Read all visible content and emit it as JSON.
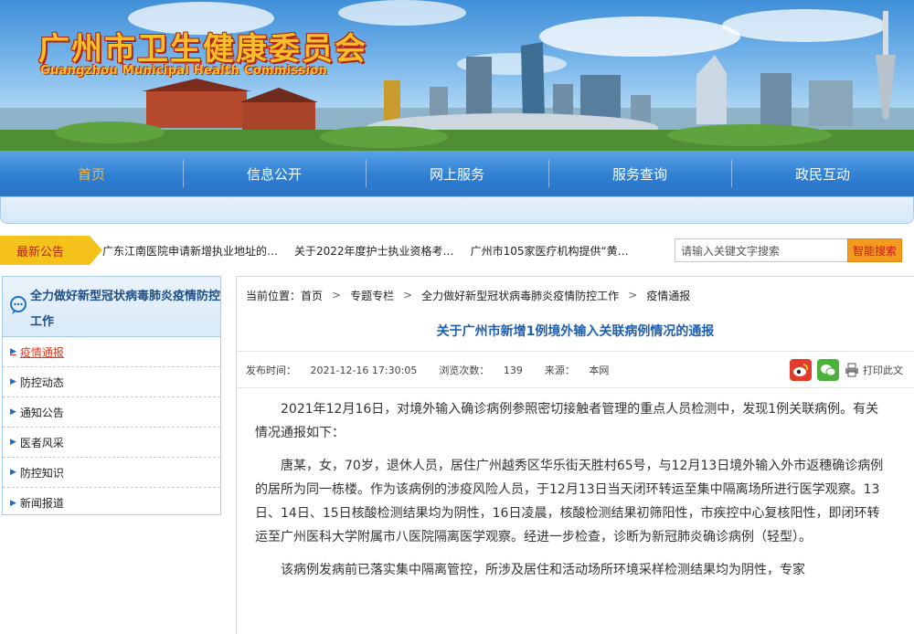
{
  "banner": {
    "title": "广州市卫生健康委员会",
    "subtitle": "Guangzhou Municipal Health Commission"
  },
  "nav": {
    "items": [
      {
        "label": "首页"
      },
      {
        "label": "信息公开"
      },
      {
        "label": "网上服务"
      },
      {
        "label": "服务查询"
      },
      {
        "label": "政民互动"
      }
    ]
  },
  "notice": {
    "label": "最新公告",
    "items": [
      "广东江南医院申请新增执业地址的…",
      "关于2022年度护士执业资格考…",
      "广州市105家医疗机构提供“黄…"
    ]
  },
  "search": {
    "placeholder": "请输入关键文字搜索",
    "button": "智能搜索"
  },
  "sidebar": {
    "heading": "全力做好新型冠状病毒肺炎疫情防控工作",
    "items": [
      {
        "label": "疫情通报"
      },
      {
        "label": "防控动态"
      },
      {
        "label": "通知公告"
      },
      {
        "label": "医者风采"
      },
      {
        "label": "防控知识"
      },
      {
        "label": "新闻报道"
      }
    ]
  },
  "breadcrumb": {
    "prefix": "当前位置：",
    "items": [
      "首页",
      "专题专栏",
      "全力做好新型冠状病毒肺炎疫情防控工作",
      "疫情通报"
    ]
  },
  "article": {
    "title": "关于广州市新增1例境外输入关联病例情况的通报",
    "publish_label": "发布时间：",
    "publish_time": "2021-12-16 17:30:05",
    "views_label": "浏览次数：",
    "views": "139",
    "source_label": "来源：",
    "source": "本网",
    "print_label": "打印此文",
    "paragraphs": [
      "2021年12月16日，对境外输入确诊病例参照密切接触者管理的重点人员检测中，发现1例关联病例。有关情况通报如下：",
      "唐某，女，70岁，退休人员，居住广州越秀区华乐街天胜村65号，与12月13日境外输入外市返穗确诊病例的居所为同一栋楼。作为该病例的涉疫风险人员，于12月13日当天闭环转运至集中隔离场所进行医学观察。13日、14日、15日核酸检测结果均为阴性，16日凌晨，核酸检测结果初筛阳性，市疾控中心复核阳性，即闭环转运至广州医科大学附属市八医院隔离医学观察。经进一步检查，诊断为新冠肺炎确诊病例（轻型）。",
      "该病例发病前已落实集中隔离管控，所涉及居住和活动场所环境采样检测结果均为阴性，专家"
    ]
  },
  "colors": {
    "nav_blue": "#2f7fd3",
    "nav_active": "#f3b83a",
    "notice_yellow": "#f4c21a",
    "title_blue": "#1e5fb0",
    "active_red": "#e5381e"
  }
}
